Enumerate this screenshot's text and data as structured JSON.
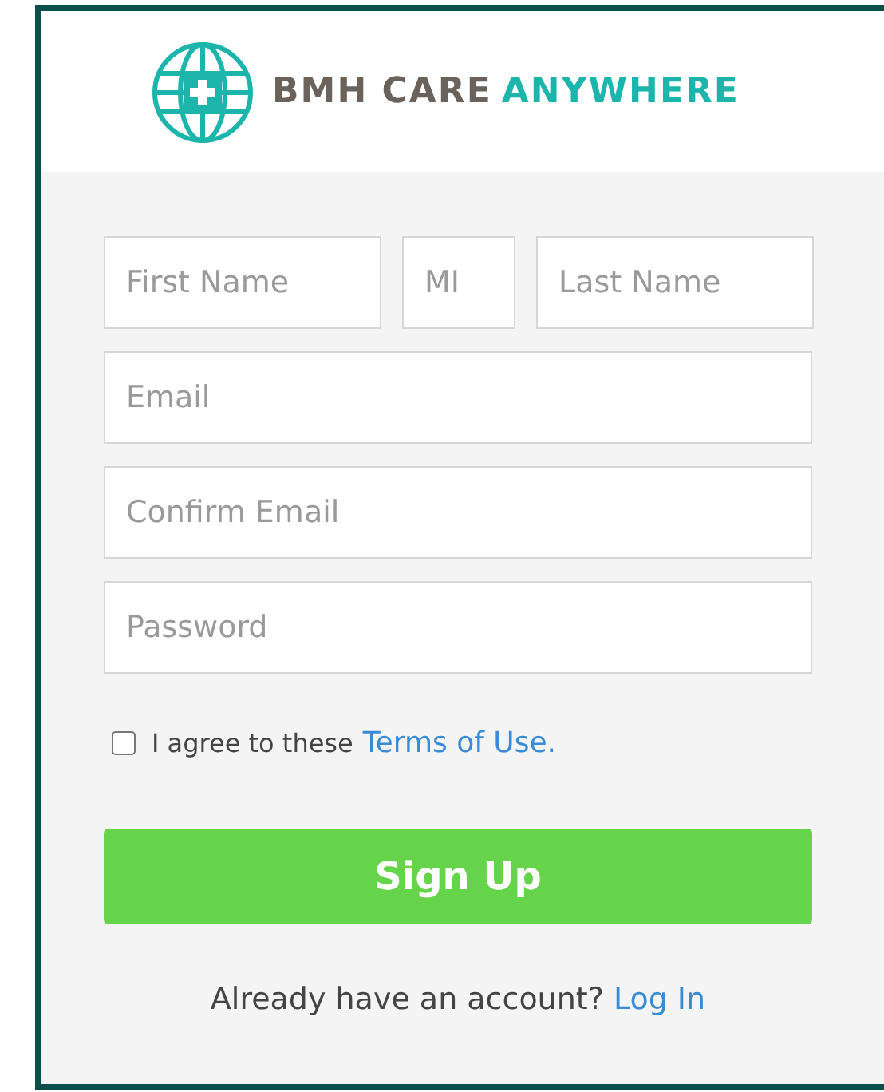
{
  "logo": {
    "brand": "BMH CARE",
    "tagline": "ANYWHERE"
  },
  "name_fields": [
    {
      "placeholder": "First Name"
    },
    {
      "placeholder": "MI"
    },
    {
      "placeholder": "Last Name"
    }
  ],
  "fields": [
    {
      "placeholder": "Email"
    },
    {
      "placeholder": "Confirm Email"
    },
    {
      "placeholder": "Password"
    }
  ],
  "agree": {
    "checked": false,
    "text": "I agree to these",
    "link": "Terms of Use."
  },
  "submit": "Sign Up",
  "login": {
    "text": "Already have an account?",
    "link": "Log In"
  }
}
